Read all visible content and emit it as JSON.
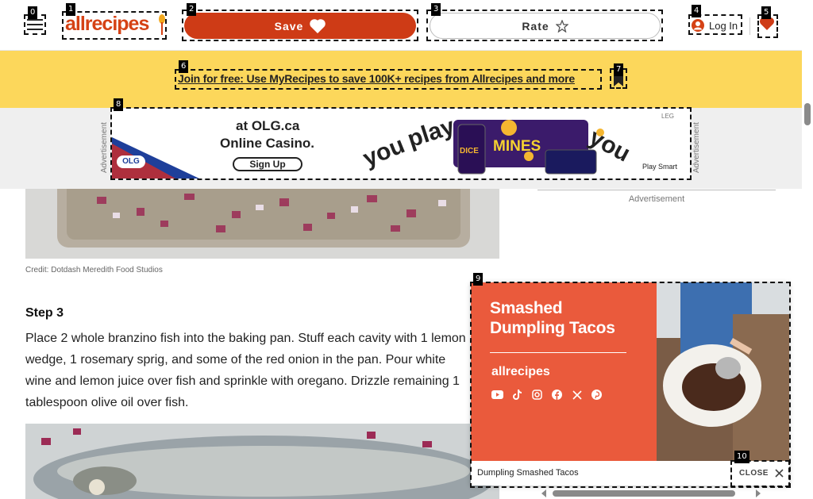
{
  "header": {
    "save_label": "Save",
    "rate_label": "Rate",
    "login_label": "Log In",
    "logo_text": "allrecipes"
  },
  "promo": {
    "link_text": "Join for free: Use MyRecipes to save 100K+ recipes from Allrecipes and more"
  },
  "ad_banner": {
    "side_label": "Advertisement",
    "headline_1": "at OLG.ca",
    "headline_2": "Online Casino.",
    "cta": "Sign Up",
    "brand": "OLG",
    "word_1": "you",
    "word_2": "play",
    "word_3": "you",
    "badge": "LEG",
    "playsmart": "Play Smart",
    "tile_1": "DICE",
    "tile_2": "MINES"
  },
  "content": {
    "credit": "Credit: Dotdash Meredith Food Studios",
    "step_title": "Step 3",
    "step_body": "Place 2 whole branzino fish into the baking pan. Stuff each cavity with 1 lemon wedge, 1 rosemary sprig, and some of the red onion in the pan. Pour white wine and lemon juice over fish and sprinkle with oregano. Drizzle remaining 1 tablespoon olive oil over fish."
  },
  "sidebar": {
    "ad_label": "Advertisement"
  },
  "video": {
    "title": "Smashed Dumpling Tacos",
    "brand": "allrecipes",
    "caption": "Dumpling Smashed Tacos",
    "close_label": "CLOSE",
    "social_icons": [
      "youtube-icon",
      "tiktok-icon",
      "instagram-icon",
      "facebook-icon",
      "x-icon",
      "pinterest-icon"
    ]
  },
  "marks": [
    "0",
    "1",
    "2",
    "3",
    "4",
    "5",
    "6",
    "7",
    "8",
    "9",
    "10"
  ],
  "colors": {
    "brand": "#ce3b16",
    "promo_bg": "#fcd75b",
    "video_bg": "#ea5a3c"
  }
}
